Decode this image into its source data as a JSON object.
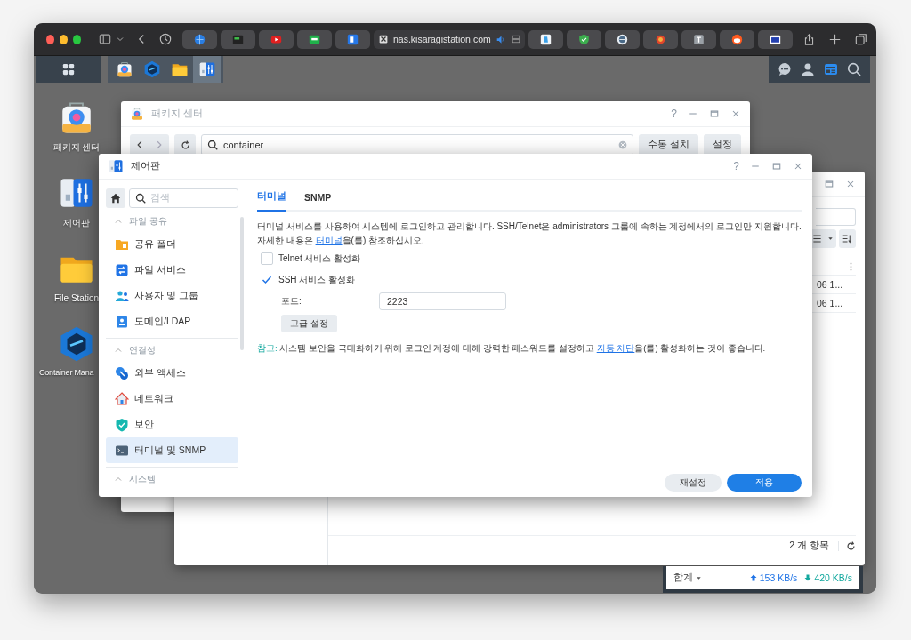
{
  "browser": {
    "address": "nas.kisaragistation.com"
  },
  "taskbar": {
    "apps": [
      {
        "kind": "package",
        "selected": false
      },
      {
        "kind": "container",
        "selected": false
      },
      {
        "kind": "folder",
        "selected": false
      },
      {
        "kind": "control",
        "selected": true
      }
    ]
  },
  "desktop_icons": [
    {
      "kind": "package",
      "label": "패키지 센터"
    },
    {
      "kind": "control",
      "label": "제어판"
    },
    {
      "kind": "folder",
      "label": "File Station"
    },
    {
      "kind": "container",
      "label": "Container Mana"
    }
  ],
  "package_center": {
    "title": "패키지 센터",
    "help": "?",
    "search": "container",
    "buttons": [
      "수동 설치",
      "설정"
    ]
  },
  "file_window": {
    "rows": [
      {
        "cell": "06 1..."
      },
      {
        "cell": "06 1..."
      }
    ],
    "count": "2 개 항목"
  },
  "resource_widget": {
    "label": "합계",
    "upload": "153 KB/s",
    "download": "420 KB/s"
  },
  "control_panel": {
    "title": "제어판",
    "help": "?",
    "search_placeholder": "검색",
    "sections": [
      {
        "title": "파일 공유",
        "expanded": true,
        "items": [
          {
            "kind": "shared-folder",
            "label": "공유 폴더",
            "selected": false
          },
          {
            "kind": "file-services",
            "label": "파일 서비스",
            "selected": false
          },
          {
            "kind": "users",
            "label": "사용자 및 그룹",
            "selected": false
          },
          {
            "kind": "domain",
            "label": "도메인/LDAP",
            "selected": false
          }
        ]
      },
      {
        "title": "연결성",
        "expanded": true,
        "items": [
          {
            "kind": "external",
            "label": "외부 액세스",
            "selected": false
          },
          {
            "kind": "network",
            "label": "네트워크",
            "selected": false
          },
          {
            "kind": "security",
            "label": "보안",
            "selected": false
          },
          {
            "kind": "terminal",
            "label": "터미널 및 SNMP",
            "selected": true
          }
        ]
      },
      {
        "title": "시스템",
        "expanded": true
      }
    ],
    "tabs": [
      {
        "label": "터미널",
        "selected": true
      },
      {
        "label": "SNMP",
        "selected": false
      }
    ],
    "description": {
      "text": "터미널 서비스를 사용하여 시스템에 로그인하고 관리합니다. SSH/Telnet은 administrators 그룹에 속하는 계정에서의 로그인만 지원합니다. 자세한 내용은 ",
      "link": "터미널",
      "after": "을(를) 참조하십시오."
    },
    "options": [
      {
        "label": "Telnet 서비스 활성화",
        "checked": false
      },
      {
        "label": "SSH 서비스 활성화",
        "checked": true
      }
    ],
    "port": {
      "label": "포트:",
      "value": "2223"
    },
    "advanced_button": "고급 설정",
    "note": {
      "label": "참고:",
      "text": " 시스템 보안을 극대화하기 위해 로그인 계정에 대해 강력한 패스워드를 설정하고 ",
      "link": "자동 차단",
      "after": "을(를) 활성화하는 것이 좋습니다."
    },
    "footer_buttons": [
      {
        "label": "재설정",
        "kind": "secondary"
      },
      {
        "label": "적용",
        "kind": "primary"
      }
    ]
  }
}
